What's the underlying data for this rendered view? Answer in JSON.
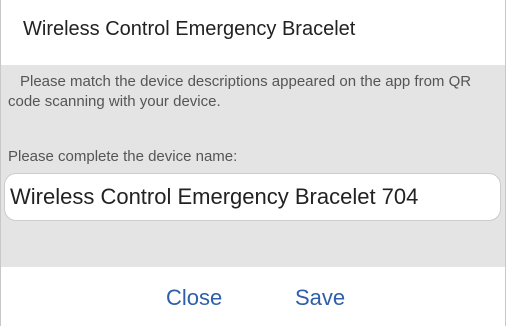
{
  "dialog": {
    "title": "Wireless Control Emergency Bracelet",
    "description": "Please match the device descriptions appeared on the app from QR code scanning with your device.",
    "name_prompt": "Please complete the device name:",
    "name_value": "Wireless Control Emergency Bracelet 704",
    "close_label": "Close",
    "save_label": "Save"
  },
  "colors": {
    "content_background": "#e4e4e4",
    "button_text": "#2e5fa8",
    "title_text": "#222222"
  }
}
